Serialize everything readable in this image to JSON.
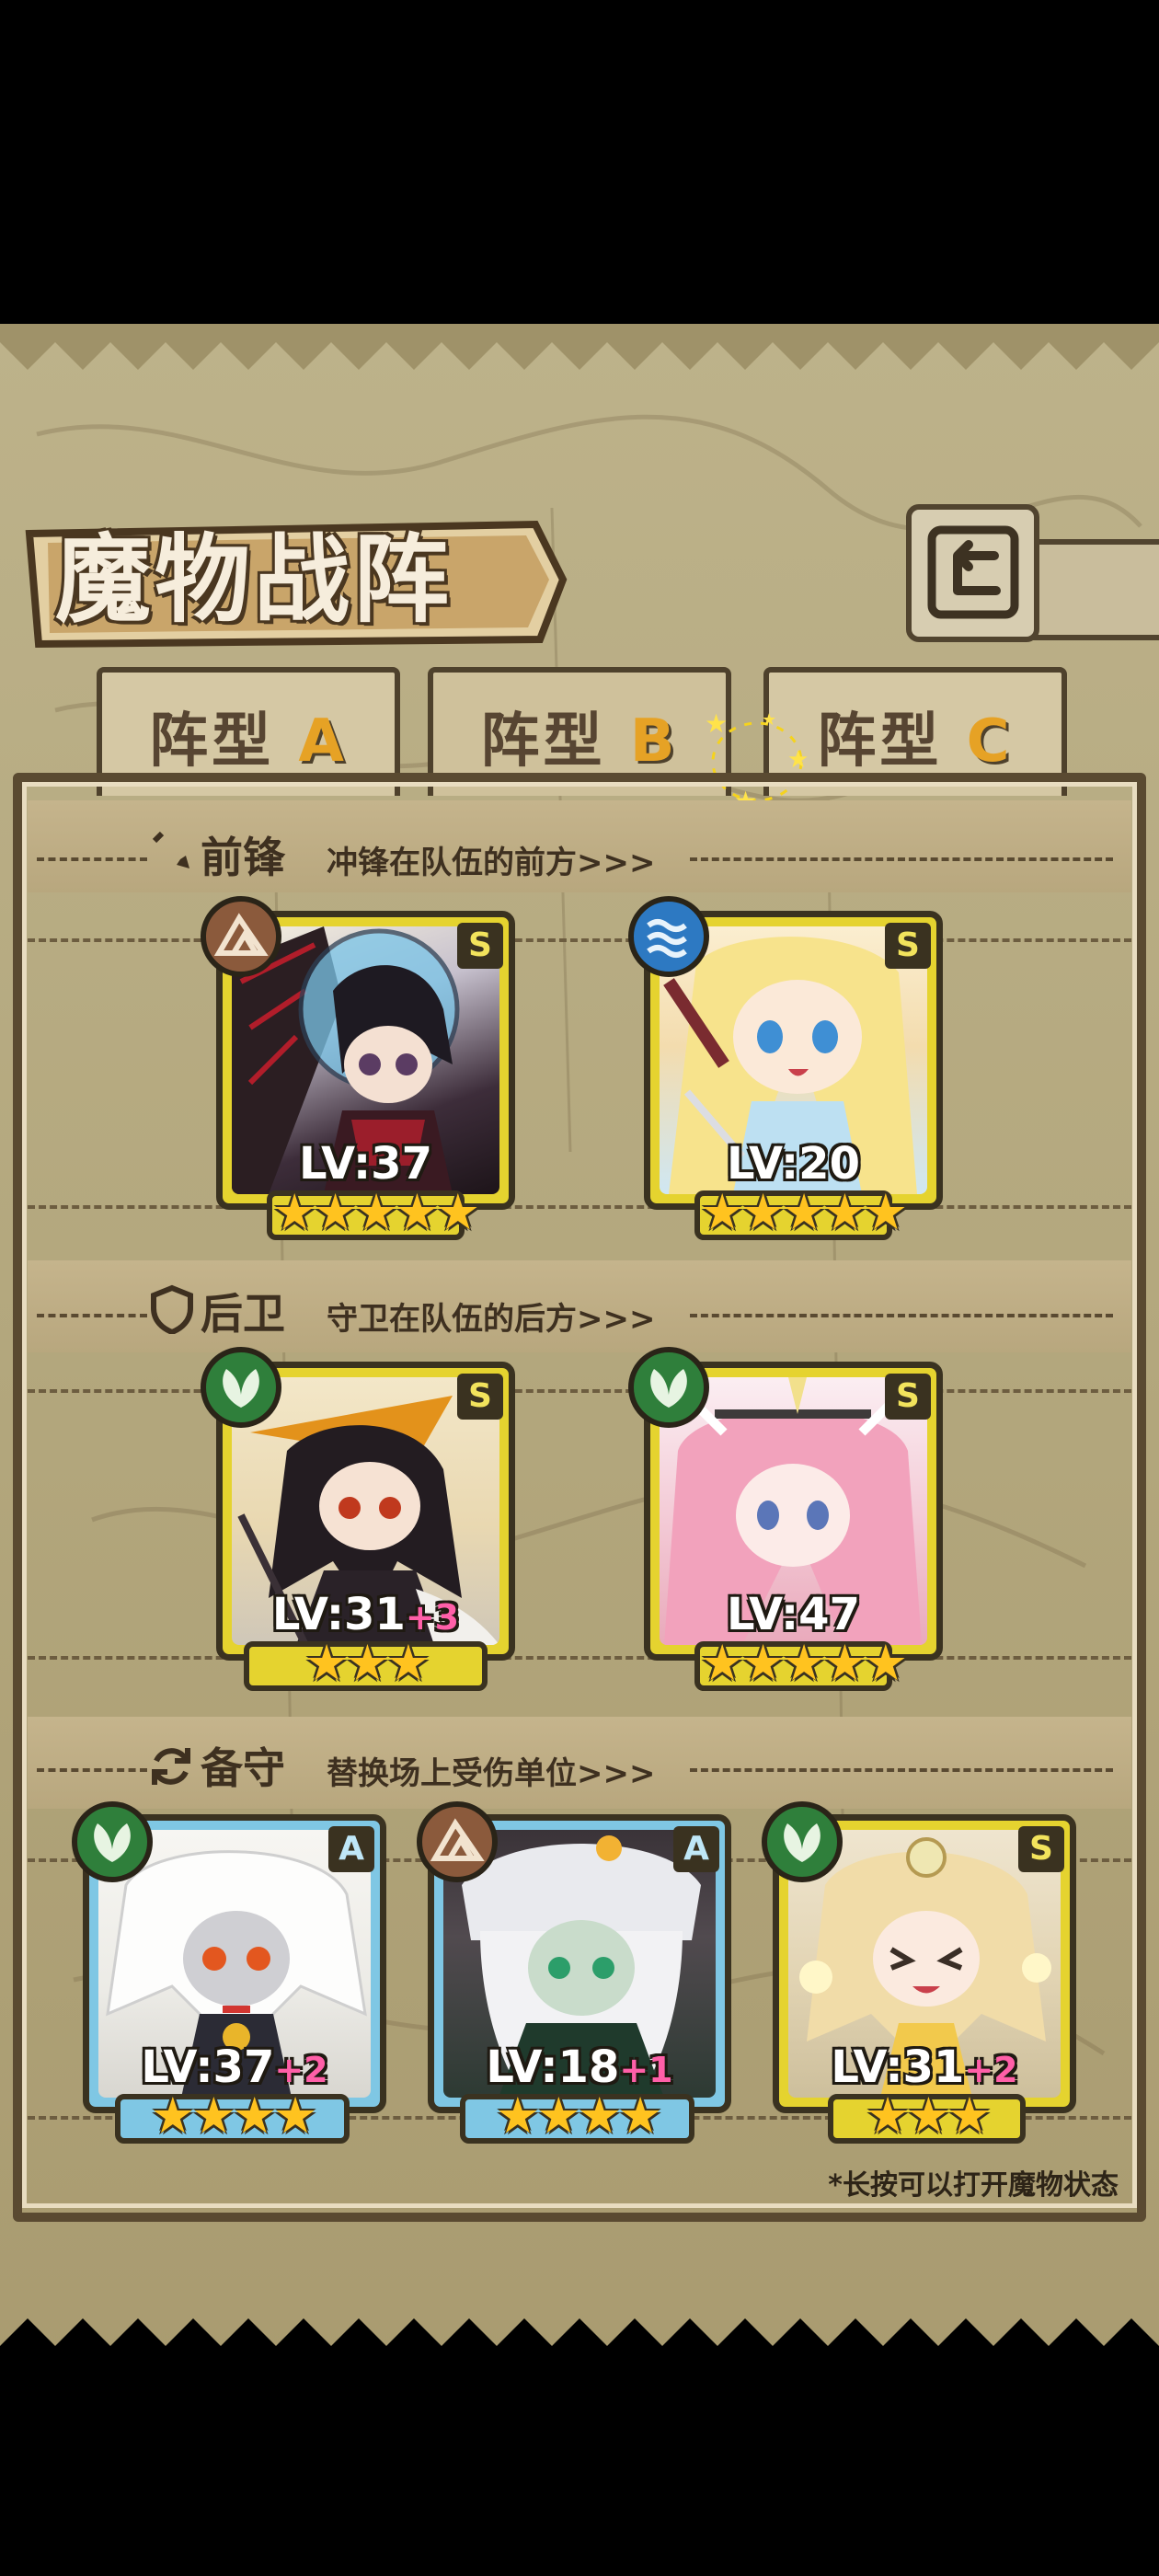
{
  "title": "魔物战阵",
  "tabs": [
    {
      "label": "阵型",
      "letter": "A"
    },
    {
      "label": "阵型",
      "letter": "B"
    },
    {
      "label": "阵型",
      "letter": "C"
    }
  ],
  "active_tab": "B",
  "sections": {
    "front": {
      "title": "前锋",
      "subtitle": "冲锋在队伍的前方>>>"
    },
    "back": {
      "title": "后卫",
      "subtitle": "守卫在队伍的后方>>>"
    },
    "reserve": {
      "title": "备守",
      "subtitle": "替换场上受伤单位>>>"
    }
  },
  "units": {
    "front_1": {
      "rank": "S",
      "element": "earth",
      "level": "LV:37",
      "plus": "",
      "stars": "★★★★★"
    },
    "front_2": {
      "rank": "S",
      "element": "water",
      "level": "LV:20",
      "plus": "",
      "stars": "★★★★★"
    },
    "back_1": {
      "rank": "S",
      "element": "nature",
      "level": "LV:31",
      "plus": "+3",
      "stars": "★★★"
    },
    "back_2": {
      "rank": "S",
      "element": "nature",
      "level": "LV:47",
      "plus": "",
      "stars": "★★★★★"
    },
    "res_1": {
      "rank": "A",
      "element": "nature",
      "level": "LV:37",
      "plus": "+2",
      "stars": "★★★★"
    },
    "res_2": {
      "rank": "A",
      "element": "earth",
      "level": "LV:18",
      "plus": "+1",
      "stars": "★★★★"
    },
    "res_3": {
      "rank": "S",
      "element": "nature",
      "level": "LV:31",
      "plus": "+2",
      "stars": "★★★"
    }
  },
  "hint": "*长按可以打开魔物状态",
  "colors": {
    "panel": "#b8ac82",
    "border": "#51442f",
    "accent": "#e6a225",
    "s_frame": "#e5d32f",
    "a_frame": "#7fc7e4",
    "plus": "#ff5fa8"
  }
}
